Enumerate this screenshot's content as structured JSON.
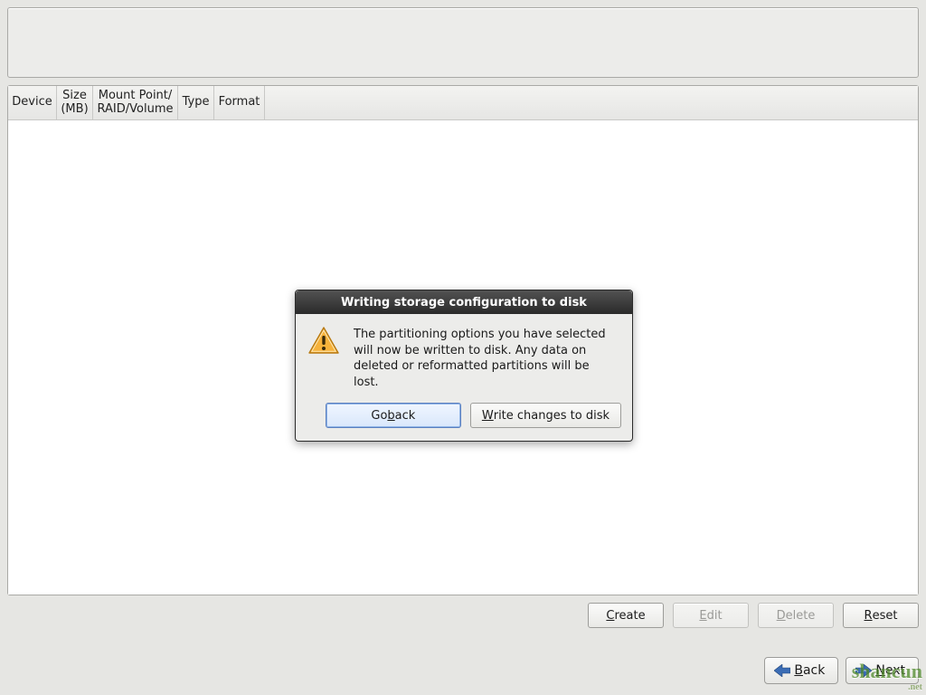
{
  "columns": {
    "device": "Device",
    "size": "Size\n(MB)",
    "mount": "Mount Point/\nRAID/Volume",
    "type": "Type",
    "format": "Format"
  },
  "actions": {
    "create": "Create",
    "edit": "Edit",
    "delete": "Delete",
    "reset": "Reset"
  },
  "nav": {
    "back": "Back",
    "next": "Next"
  },
  "dialog": {
    "title": "Writing storage configuration to disk",
    "message": "The partitioning options you have selected will now be written to disk.  Any data on deleted or reformatted partitions will be lost.",
    "go_back": "Go back",
    "write": "Write changes to disk"
  },
  "watermark": {
    "main": "shancun",
    "sub": ".net"
  },
  "mnemonics": {
    "create": "C",
    "edit": "E",
    "delete": "D",
    "reset": "R",
    "back": "B",
    "next": "N",
    "go_back": "b",
    "write": "W"
  }
}
